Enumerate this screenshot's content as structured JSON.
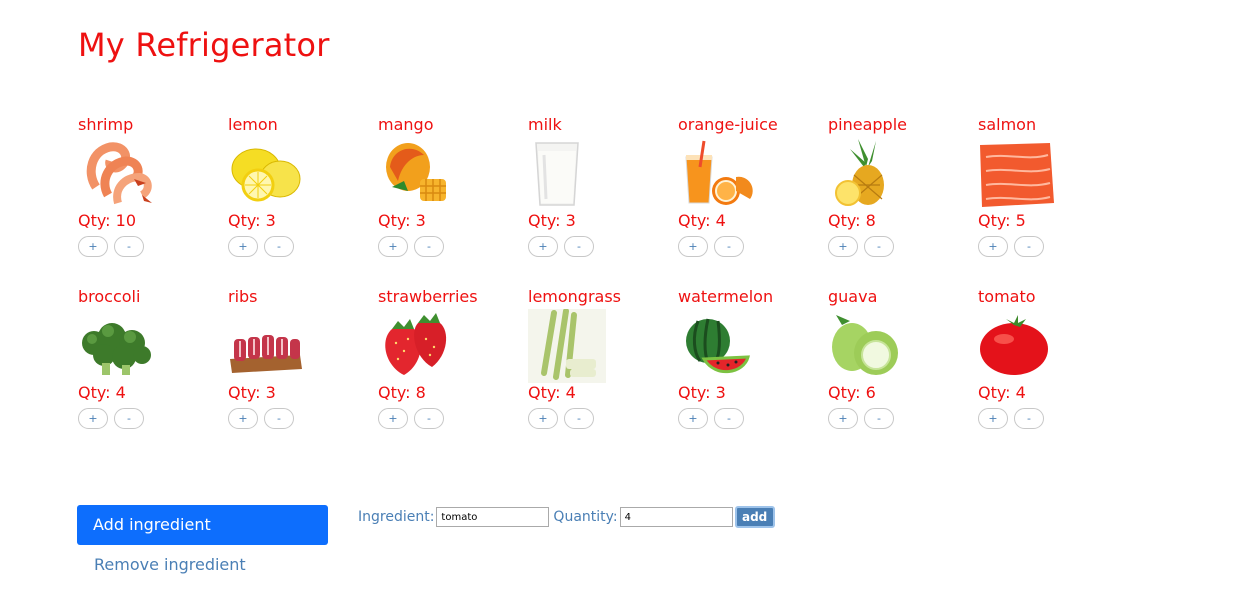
{
  "page": {
    "title": "My Refrigerator"
  },
  "colors": {
    "accent": "#ee1111",
    "primary": "#0d6efd",
    "link": "#4a7fb5"
  },
  "items": [
    {
      "name": "shrimp",
      "qty_label": "Qty: 10",
      "icon": "shrimp-icon"
    },
    {
      "name": "lemon",
      "qty_label": "Qty: 3",
      "icon": "lemon-icon"
    },
    {
      "name": "mango",
      "qty_label": "Qty: 3",
      "icon": "mango-icon"
    },
    {
      "name": "milk",
      "qty_label": "Qty: 3",
      "icon": "milk-icon"
    },
    {
      "name": "orange-juice",
      "qty_label": "Qty: 4",
      "icon": "orange-juice-icon"
    },
    {
      "name": "pineapple",
      "qty_label": "Qty: 8",
      "icon": "pineapple-icon"
    },
    {
      "name": "salmon",
      "qty_label": "Qty: 5",
      "icon": "salmon-icon"
    },
    {
      "name": "broccoli",
      "qty_label": "Qty: 4",
      "icon": "broccoli-icon"
    },
    {
      "name": "ribs",
      "qty_label": "Qty: 3",
      "icon": "ribs-icon"
    },
    {
      "name": "strawberries",
      "qty_label": "Qty: 8",
      "icon": "strawberries-icon"
    },
    {
      "name": "lemongrass",
      "qty_label": "Qty: 4",
      "icon": "lemongrass-icon"
    },
    {
      "name": "watermelon",
      "qty_label": "Qty: 3",
      "icon": "watermelon-icon"
    },
    {
      "name": "guava",
      "qty_label": "Qty: 6",
      "icon": "guava-icon"
    },
    {
      "name": "tomato",
      "qty_label": "Qty: 4",
      "icon": "tomato-icon"
    }
  ],
  "buttons": {
    "plus": "+",
    "minus": "-"
  },
  "actions": {
    "add_ingredient": "Add ingredient",
    "remove_ingredient": "Remove ingredient"
  },
  "form": {
    "ingredient_label": "Ingredient:",
    "ingredient_value": "tomato",
    "quantity_label": "Quantity:",
    "quantity_value": "4",
    "submit_label": "add"
  }
}
